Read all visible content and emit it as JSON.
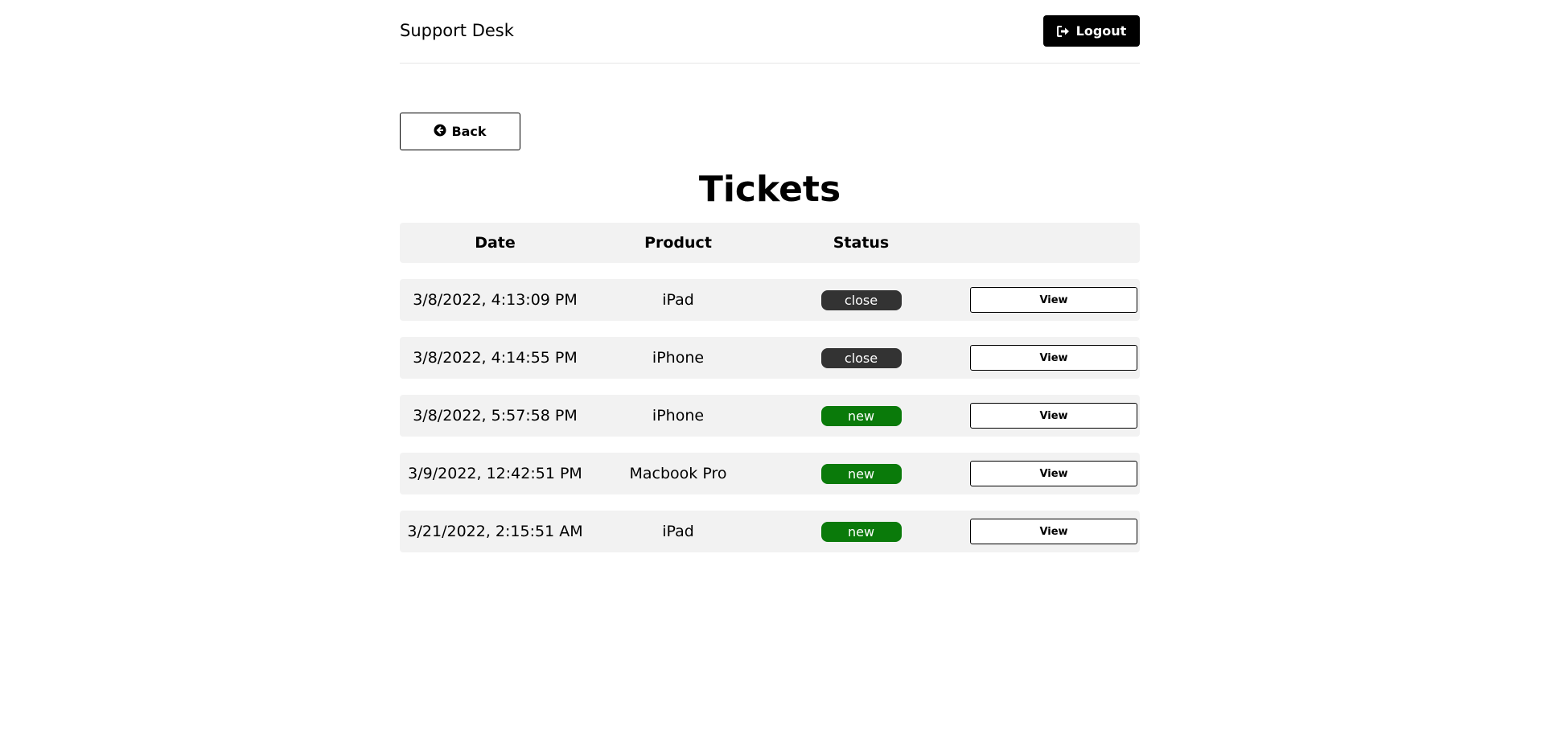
{
  "header": {
    "brand": "Support Desk",
    "logout_label": "Logout"
  },
  "nav": {
    "back_label": "Back"
  },
  "page_title": "Tickets",
  "table": {
    "columns": [
      "Date",
      "Product",
      "Status",
      ""
    ],
    "rows": [
      {
        "date": "3/8/2022, 4:13:09 PM",
        "product": "iPad",
        "status": "close",
        "action": "View"
      },
      {
        "date": "3/8/2022, 4:14:55 PM",
        "product": "iPhone",
        "status": "close",
        "action": "View"
      },
      {
        "date": "3/8/2022, 5:57:58 PM",
        "product": "iPhone",
        "status": "new",
        "action": "View"
      },
      {
        "date": "3/9/2022, 12:42:51 PM",
        "product": "Macbook Pro",
        "status": "new",
        "action": "View"
      },
      {
        "date": "3/21/2022, 2:15:51 AM",
        "product": "iPad",
        "status": "new",
        "action": "View"
      }
    ]
  },
  "colors": {
    "status_close": "#333333",
    "status_new": "#0a7a0a",
    "row_bg": "#f2f2f2",
    "primary": "#000000"
  },
  "icons": {
    "logout": "sign-out-icon",
    "back": "arrow-circle-left-icon"
  }
}
